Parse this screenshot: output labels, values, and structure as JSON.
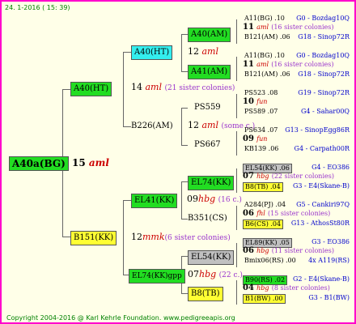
{
  "header": "24. 1-2016 ( 15: 39)",
  "footer": "Copyright 2004-2016 @ Karl Kehrle Foundation.   www.pedigreeapis.org",
  "root": {
    "label": "A40a(BG)",
    "gen_num": "15",
    "gen_note": "aml"
  },
  "sire": {
    "label": "A40(HT)",
    "gen_num": "14",
    "gen_note": "aml",
    "siblings": "(21 sister colonies)"
  },
  "dam": {
    "label": "B151(KK)",
    "gen_num": "12",
    "gen_note": "mmk",
    "siblings": "(6 sister colonies)"
  },
  "ss": {
    "label": "A40(HT)",
    "gen_num": "12",
    "gen_note": "aml"
  },
  "sd": {
    "label": "B226(AM)",
    "gen_num": "12",
    "gen_note": "aml",
    "siblings": "(some c.)"
  },
  "ds": {
    "label": "EL41(KK)",
    "gen_num": "09",
    "gen_note": "hbg",
    "siblings": "(16 c.)"
  },
  "dd": {
    "label": "EL74(KK)gpp",
    "gen_num": "07",
    "gen_note": "hbg",
    "siblings": "(22 c.)"
  },
  "g3": [
    {
      "label": "A40(AM)",
      "box": "g"
    },
    {
      "label": "A41(AM)",
      "box": "g"
    },
    {
      "label": "PS559",
      "box": ""
    },
    {
      "label": "PS667",
      "box": ""
    },
    {
      "label": "EL74(KK)",
      "box": "g"
    },
    {
      "label": "B351(CS)",
      "box": ""
    },
    {
      "label": "EL54(KK)",
      "box": "gray"
    },
    {
      "label": "B8(TB)",
      "box": "y"
    }
  ],
  "g4": [
    {
      "top": "A11(BG) .10",
      "topr": "G0 - Bozdag10Q",
      "mid_num": "11",
      "mid_note": "aml",
      "mid_sib": "(16 sister colonies)",
      "bot": "B121(AM) .06",
      "botr": "G18 - Sinop72R"
    },
    {
      "top": "A11(BG) .10",
      "topr": "G0 - Bozdag10Q",
      "mid_num": "11",
      "mid_note": "aml",
      "mid_sib": "(16 sister colonies)",
      "bot": "B121(AM) .06",
      "botr": "G18 - Sinop72R"
    },
    {
      "top": "PS523 .08",
      "topr": "G19 - Sinop72R",
      "mid_num": "10",
      "mid_note": "fun",
      "mid_sib": "",
      "bot": "PS589 .07",
      "botr": "G4 - Sahar00Q"
    },
    {
      "top": "PS634 .07",
      "topr": "G13 - SinopEgg86R",
      "mid_num": "09",
      "mid_note": "fun",
      "mid_sib": "",
      "bot": "KB139 .06",
      "botr": "G4 - Carpath00R"
    },
    {
      "top": "EL54(KK) .06",
      "topr": "G4 - EO386",
      "mid_num": "07",
      "mid_note": "hbg",
      "mid_sib": "(22 sister colonies)",
      "bot": "B8(TB) .04",
      "botr": "G3 - E4(Skane-B)"
    },
    {
      "top": "A284(PJ) .04",
      "topr": "G5 - Cankiri97Q",
      "mid_num": "06",
      "mid_note": "fhl",
      "mid_sib": "(15 sister colonies)",
      "bot": "B6(CS) .04",
      "botr": "G13 - AthosSt80R"
    },
    {
      "top": "EL89(KK) .05",
      "topr": "G3 - EO386",
      "mid_num": "06",
      "mid_note": "hbg",
      "mid_sib": "(11 sister colonies)",
      "bot": "Bmix06(RS) .00",
      "botr": "4x A119(RS)"
    },
    {
      "top": "B90(RS) .02",
      "topr": "G2 - E4(Skane-B)",
      "mid_num": "04",
      "mid_note": "hbg",
      "mid_sib": "(8 sister colonies)",
      "bot": "B1(BW) .00",
      "botr": "G3 - B1(BW)"
    }
  ]
}
